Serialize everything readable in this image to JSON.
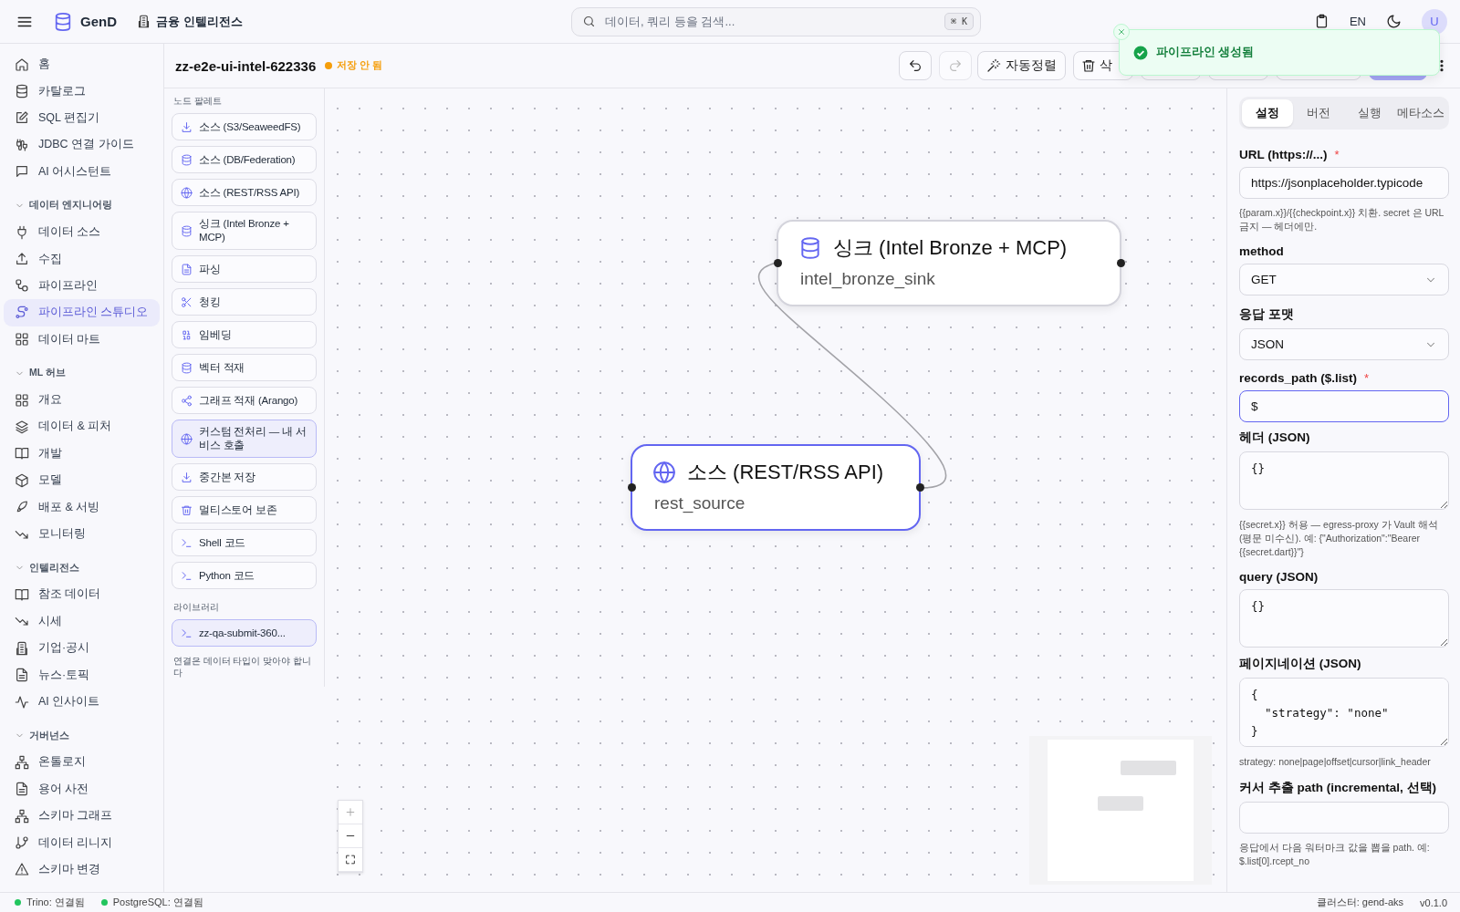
{
  "topbar": {
    "brand": "GenD",
    "workspace": "금융 인텔리전스",
    "search": {
      "placeholder": "데이터, 쿼리 등을 검색...",
      "shortcut": "⌘ K"
    },
    "language": "EN",
    "avatar": "U"
  },
  "sidebar": {
    "items": [
      {
        "label": "홈",
        "selected": false
      },
      {
        "label": "카탈로그",
        "selected": false
      },
      {
        "label": "SQL 편집기",
        "selected": false
      },
      {
        "label": "JDBC 연결 가이드",
        "selected": false
      },
      {
        "label": "AI 어시스턴트",
        "selected": false
      }
    ],
    "groups": [
      {
        "title": "데이터 엔지니어링",
        "expanded": true,
        "items": [
          {
            "label": "데이터 소스",
            "selected": false
          },
          {
            "label": "수집",
            "selected": false
          },
          {
            "label": "파이프라인",
            "selected": false
          },
          {
            "label": "파이프라인 스튜디오",
            "selected": true
          },
          {
            "label": "데이터 마트",
            "selected": false
          }
        ]
      },
      {
        "title": "ML 허브",
        "expanded": true,
        "items": [
          {
            "label": "개요",
            "selected": false
          },
          {
            "label": "데이터 & 피처",
            "selected": false
          },
          {
            "label": "개발",
            "selected": false
          },
          {
            "label": "모델",
            "selected": false
          },
          {
            "label": "배포 & 서빙",
            "selected": false
          },
          {
            "label": "모니터링",
            "selected": false
          }
        ]
      },
      {
        "title": "인텔리전스",
        "expanded": true,
        "items": [
          {
            "label": "참조 데이터",
            "selected": false
          },
          {
            "label": "시세",
            "selected": false
          },
          {
            "label": "기업·공시",
            "selected": false
          },
          {
            "label": "뉴스·토픽",
            "selected": false
          },
          {
            "label": "AI 인사이트",
            "selected": false
          }
        ]
      },
      {
        "title": "거버넌스",
        "expanded": true,
        "items": [
          {
            "label": "온톨로지",
            "selected": false
          },
          {
            "label": "용어 사전",
            "selected": false
          },
          {
            "label": "스키마 그래프",
            "selected": false
          },
          {
            "label": "데이터 리니지",
            "selected": false
          },
          {
            "label": "스키마 변경",
            "selected": false
          }
        ]
      }
    ]
  },
  "toolbar": {
    "pipeline_name": "zz-e2e-ui-intel-622336",
    "save_status": "저장 안 됨",
    "saved": false,
    "buttons": [
      {
        "kind": "undo",
        "disabled": false
      },
      {
        "kind": "redo",
        "disabled": true
      },
      {
        "kind": "auto_layout",
        "label": "자동정렬",
        "disabled": false
      },
      {
        "kind": "delete",
        "label": "삭",
        "disabled": false
      },
      {
        "kind": "covered",
        "disabled": false
      },
      {
        "kind": "covered",
        "disabled": false
      },
      {
        "kind": "covered",
        "disabled": false
      },
      {
        "kind": "primary",
        "disabled": true
      }
    ]
  },
  "toast": {
    "message": "파이프라인 생성됨"
  },
  "palette": {
    "title": "노드 팔레트",
    "items": [
      {
        "label": "소스 (S3/SeaweedFS)",
        "highlighted": false
      },
      {
        "label": "소스 (DB/Federation)",
        "highlighted": false
      },
      {
        "label": "소스 (REST/RSS API)",
        "highlighted": false
      },
      {
        "label": "싱크 (Intel Bronze + MCP)",
        "highlighted": false
      },
      {
        "label": "파싱",
        "highlighted": false
      },
      {
        "label": "청킹",
        "highlighted": false
      },
      {
        "label": "임베딩",
        "highlighted": false
      },
      {
        "label": "벡터 적재",
        "highlighted": false
      },
      {
        "label": "그래프 적재 (Arango)",
        "highlighted": false
      },
      {
        "label": "커스텀 전처리 — 내 서비스 호출",
        "highlighted": true
      },
      {
        "label": "중간본 저장",
        "highlighted": false
      },
      {
        "label": "멀티스토어 보존",
        "highlighted": false
      },
      {
        "label": "Shell 코드",
        "highlighted": false
      },
      {
        "label": "Python 코드",
        "highlighted": false
      }
    ],
    "library_title": "라이브러리",
    "library": [
      {
        "label": "zz-qa-submit-360...",
        "highlighted": true
      }
    ],
    "footnote": "연결은 데이터 타입이 맞아야 합니다"
  },
  "canvas": {
    "nodes": [
      {
        "kind": "sink",
        "title": "싱크 (Intel Bronze + MCP)",
        "subtitle": "intel_bronze_sink",
        "selected": false
      },
      {
        "kind": "source",
        "title": "소스 (REST/RSS API)",
        "subtitle": "rest_source",
        "selected": true
      }
    ]
  },
  "inspector": {
    "tabs": [
      {
        "label": "설정",
        "selected": true
      },
      {
        "label": "버전",
        "selected": false
      },
      {
        "label": "실행",
        "selected": false
      },
      {
        "label": "메타소스",
        "selected": false
      }
    ],
    "fields": [
      {
        "kind": "input",
        "label": "URL (https://...)",
        "required_mark": "*",
        "value": "https://jsonplaceholder.typicode",
        "focused": false,
        "hint": "{{param.x}}/{{checkpoint.x}} 치환. secret 은 URL 금지 — 헤더에만."
      },
      {
        "kind": "select",
        "label": "method",
        "value": "GET"
      },
      {
        "kind": "select",
        "label": "응답 포맷",
        "value": "JSON"
      },
      {
        "kind": "input",
        "label": "records_path ($.list)",
        "required_mark": "*",
        "value": "$",
        "focused": true
      },
      {
        "kind": "textarea",
        "label": "헤더 (JSON)",
        "value": "{}",
        "hint": "{{secret.x}} 허용 — egress-proxy 가 Vault 해석 (평문 미수신). 예: {\"Authorization\":\"Bearer {{secret.dart}}\"}"
      },
      {
        "kind": "textarea",
        "label": "query (JSON)",
        "value": "{}"
      },
      {
        "kind": "textarea",
        "label": "페이지네이션 (JSON)",
        "value": "{\n  \"strategy\": \"none\"\n}",
        "hint": "strategy: none|page|offset|cursor|link_header"
      },
      {
        "kind": "input",
        "label": "커서 추출 path (incremental, 선택)",
        "focused": false,
        "hint": "응답에서 다음 워터마크 값을 뽑을 path. 예: $.list[0].rcept_no"
      }
    ]
  },
  "status_bar": {
    "connections": [
      {
        "label": "Trino: 연결됨",
        "connected": true
      },
      {
        "label": "PostgreSQL: 연결됨",
        "connected": true
      }
    ],
    "cluster": "클러스터: gend-aks",
    "version": "v0.1.0"
  }
}
